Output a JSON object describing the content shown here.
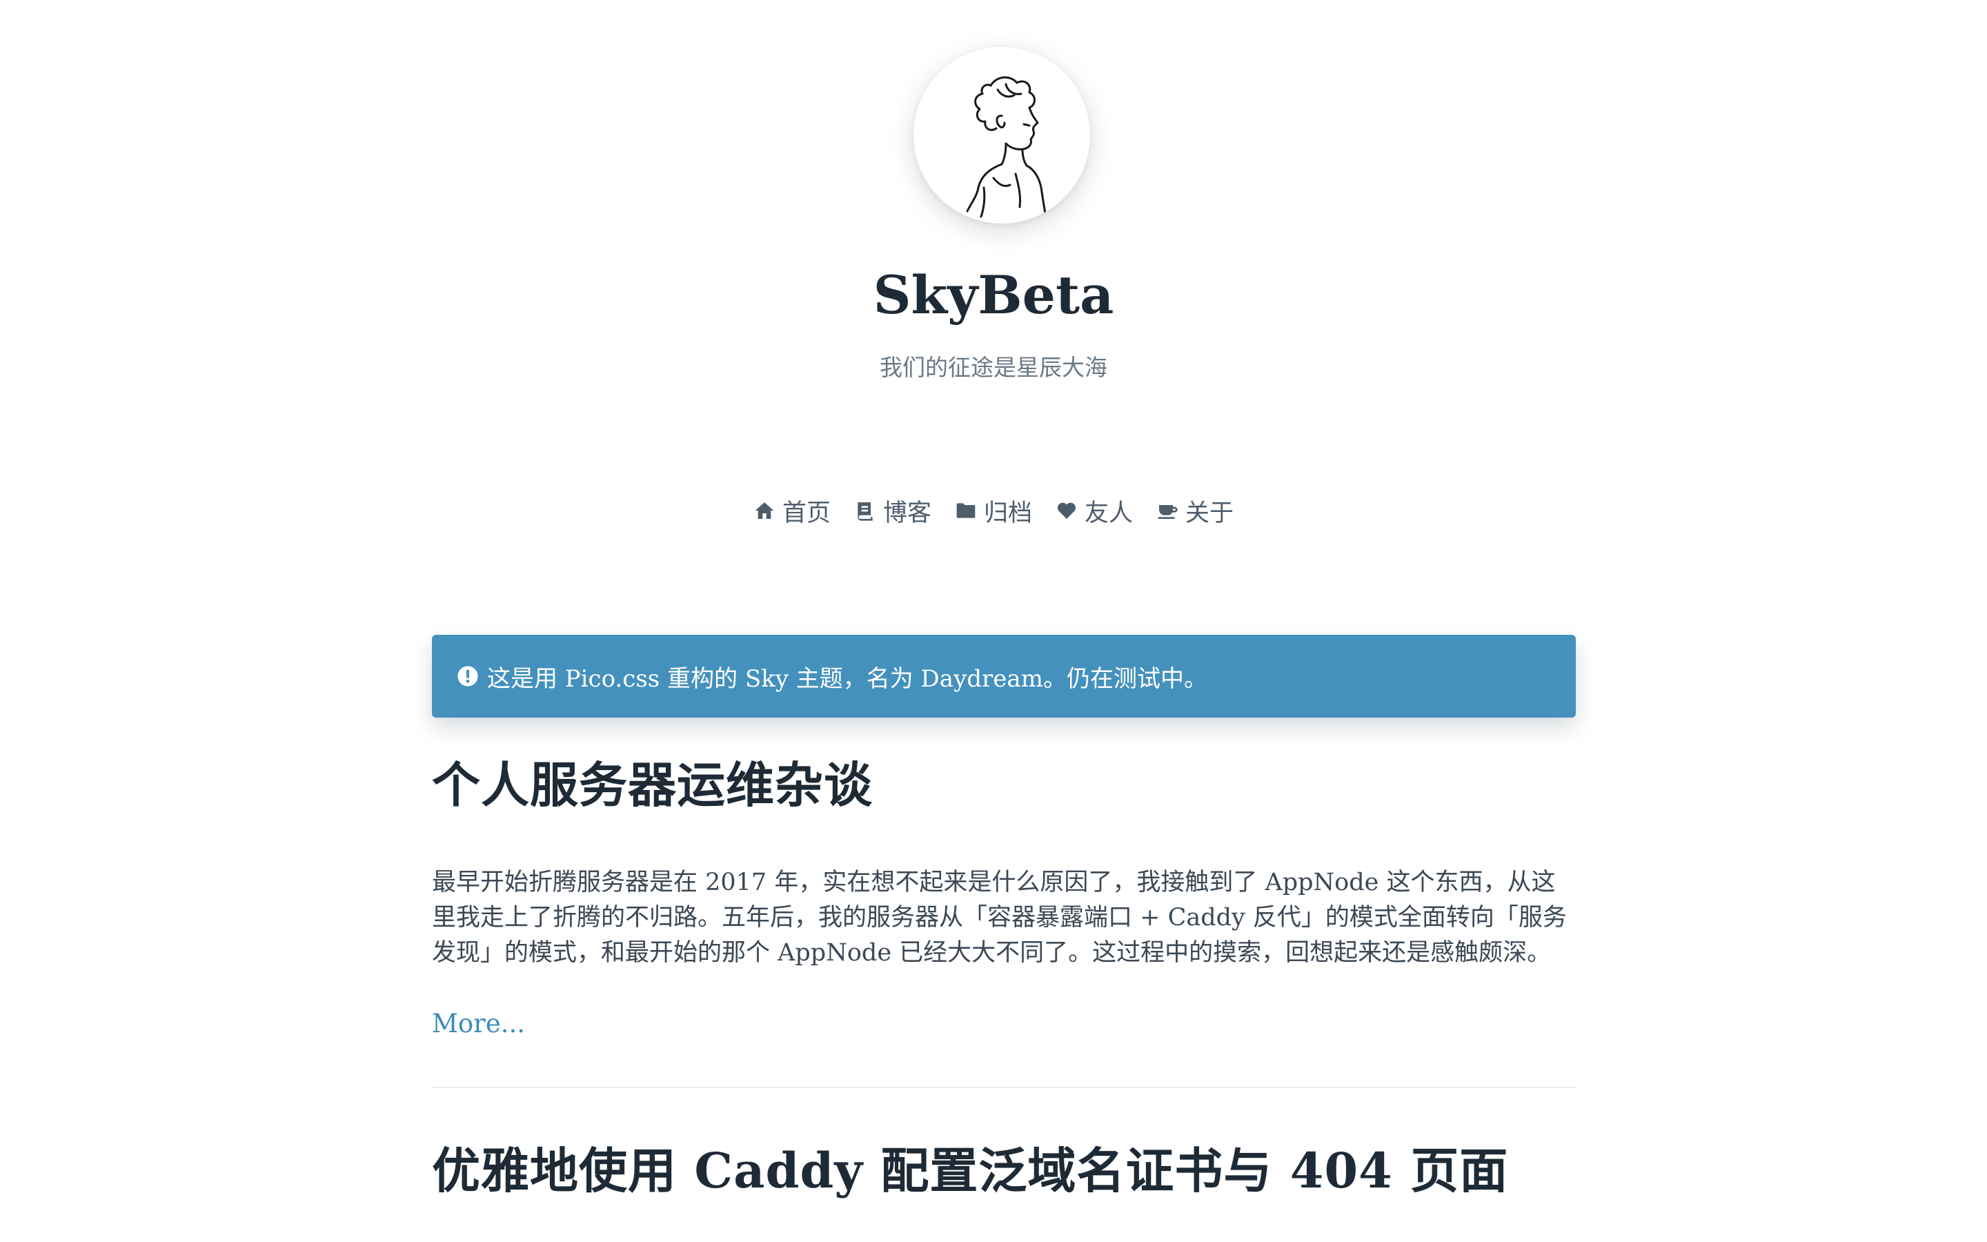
{
  "site": {
    "title": "SkyBeta",
    "subtitle": "我们的征途是星辰大海",
    "avatar_icon": "sketch-avatar"
  },
  "nav": {
    "items": [
      {
        "label": "首页",
        "icon": "home-icon"
      },
      {
        "label": "博客",
        "icon": "book-icon"
      },
      {
        "label": "归档",
        "icon": "folder-icon"
      },
      {
        "label": "友人",
        "icon": "heart-icon"
      },
      {
        "label": "关于",
        "icon": "coffee-icon"
      }
    ]
  },
  "notice": {
    "icon": "exclamation-circle-icon",
    "text": "这是用 Pico.css 重构的 Sky 主题，名为 Daydream。仍在测试中。",
    "background": "#4491bd"
  },
  "posts": [
    {
      "title": "个人服务器运维杂谈",
      "excerpt": "最早开始折腾服务器是在 2017 年，实在想不起来是什么原因了，我接触到了 AppNode 这个东西，从这里我走上了折腾的不归路。五年后，我的服务器从「容器暴露端口 + Caddy 反代」的模式全面转向「服务发现」的模式，和最开始的那个 AppNode 已经大大不同了。这过程中的摸索，回想起来还是感触颇深。",
      "more": "More..."
    },
    {
      "title": "优雅地使用 Caddy 配置泛域名证书与 404 页面"
    }
  ],
  "colors": {
    "link": "#3d8bbd",
    "text": "#1e2a35",
    "muted": "#6b7987"
  }
}
